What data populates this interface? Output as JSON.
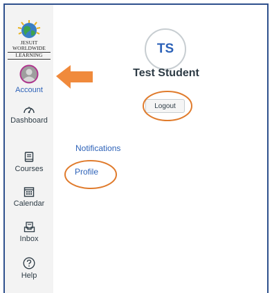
{
  "logo": {
    "line1": "JESUIT",
    "line2": "WORLDWIDE",
    "line3": "LEARNING"
  },
  "sidebar": {
    "items": [
      {
        "label": "Account",
        "icon": "avatar-icon"
      },
      {
        "label": "Dashboard",
        "icon": "dashboard-gauge-icon"
      },
      {
        "label": "Courses",
        "icon": "book-icon"
      },
      {
        "label": "Calendar",
        "icon": "calendar-icon"
      },
      {
        "label": "Inbox",
        "icon": "inbox-icon"
      },
      {
        "label": "Help",
        "icon": "question-circle-icon"
      }
    ]
  },
  "profile": {
    "initials": "TS",
    "name": "Test Student",
    "logout_label": "Logout"
  },
  "links": {
    "notifications": "Notifications",
    "profile": "Profile"
  },
  "colors": {
    "accent": "#2d62b8",
    "annotation": "#e07b2c",
    "frame": "#2d4f8c"
  }
}
